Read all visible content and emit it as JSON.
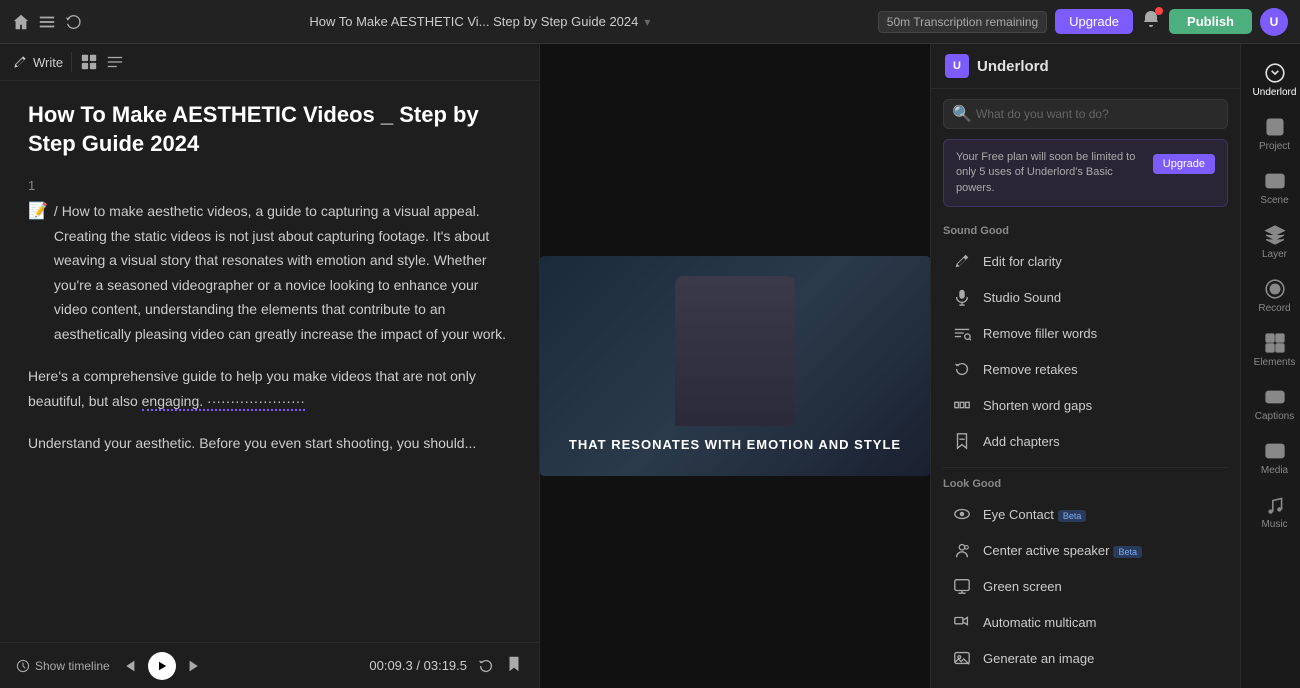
{
  "topbar": {
    "project_title": "How To Make AESTHETIC Vi... Step by Step Guide 2024",
    "transcription_label": "50m Transcription remaining",
    "upgrade_label": "Upgrade",
    "publish_label": "Publish",
    "user_initial": "U"
  },
  "toolbar": {
    "write_label": "Write",
    "layout_icon": "layout"
  },
  "doc": {
    "title": "How To Make AESTHETIC Videos _ Step by Step Guide 2024",
    "section_num": "1",
    "body1": "/ How to make aesthetic videos, a guide to capturing a visual appeal. Creating the static videos is not just about capturing footage. It's about weaving a visual story that resonates with emotion and style. Whether you're a seasoned videographer or a novice looking to enhance your video content, understanding the elements that contribute to an aesthetically pleasing video can greatly increase the impact of your work.",
    "body2": "Here's a comprehensive guide to help you make videos that are not only beautiful, but also engaging.",
    "body3": "Understand your aesthetic. Before you even start shooting, you should..."
  },
  "video": {
    "caption": "THAT RESONATES WITH EMOTION AND STYLE"
  },
  "playback": {
    "current_time": "00:09.3",
    "separator": "/",
    "total_time": "03:19.5",
    "timeline_label": "Show timeline"
  },
  "underlord": {
    "title": "Underlord",
    "search_placeholder": "What do you want to do?",
    "upgrade_notice": "Your Free plan will soon be limited to only 5 uses of Underlord's Basic powers.",
    "upgrade_btn": "Upgrade",
    "sound_good_label": "Sound Good",
    "features": [
      {
        "id": "edit-clarity",
        "label": "Edit for clarity",
        "icon": "edit"
      },
      {
        "id": "studio-sound",
        "label": "Studio Sound",
        "icon": "mic"
      },
      {
        "id": "remove-filler",
        "label": "Remove filler words",
        "icon": "filler"
      },
      {
        "id": "remove-retakes",
        "label": "Remove retakes",
        "icon": "retakes"
      },
      {
        "id": "shorten-gaps",
        "label": "Shorten word gaps",
        "icon": "gaps"
      },
      {
        "id": "add-chapters",
        "label": "Add chapters",
        "icon": "chapters"
      }
    ],
    "look_good_label": "Look Good",
    "look_features": [
      {
        "id": "eye-contact",
        "label": "Eye Contact",
        "icon": "eye",
        "badge": "Beta"
      },
      {
        "id": "center-speaker",
        "label": "Center active speaker",
        "icon": "speaker",
        "badge": "Beta"
      },
      {
        "id": "green-screen",
        "label": "Green screen",
        "icon": "greenscreen",
        "badge": ""
      },
      {
        "id": "auto-multicam",
        "label": "Automatic multicam",
        "icon": "multicam",
        "badge": ""
      },
      {
        "id": "generate-image",
        "label": "Generate an image",
        "icon": "image",
        "badge": ""
      }
    ]
  },
  "sidebar": {
    "items": [
      {
        "id": "underlord",
        "label": "Underlord",
        "active": true
      },
      {
        "id": "project",
        "label": "Project",
        "active": false
      },
      {
        "id": "scene",
        "label": "Scene",
        "active": false
      },
      {
        "id": "layer",
        "label": "Layer",
        "active": false
      },
      {
        "id": "record",
        "label": "Record",
        "active": false
      },
      {
        "id": "elements",
        "label": "Elements",
        "active": false
      },
      {
        "id": "captions",
        "label": "Captions",
        "active": false
      },
      {
        "id": "media",
        "label": "Media",
        "active": false
      },
      {
        "id": "music",
        "label": "Music",
        "active": false
      }
    ]
  }
}
